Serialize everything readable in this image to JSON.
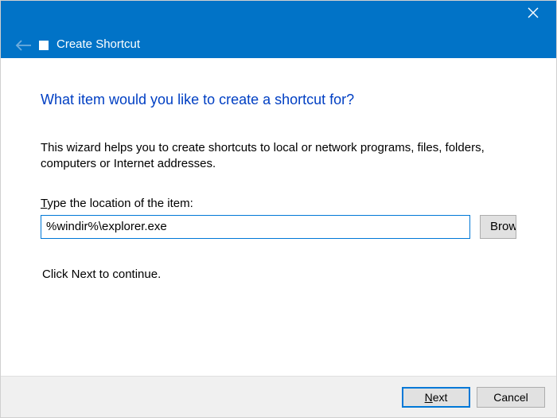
{
  "titlebar": {
    "title": "Create Shortcut"
  },
  "content": {
    "heading": "What item would you like to create a shortcut for?",
    "description": "This wizard helps you to create shortcuts to local or network programs, files, folders, computers or Internet addresses.",
    "location_label_pre": "T",
    "location_label_post": "ype the location of the item:",
    "location_value": "%windir%\\explorer.exe",
    "browse_label": "Browse...",
    "continue_text": "Click Next to continue."
  },
  "footer": {
    "next_pre": "N",
    "next_post": "ext",
    "cancel": "Cancel"
  }
}
